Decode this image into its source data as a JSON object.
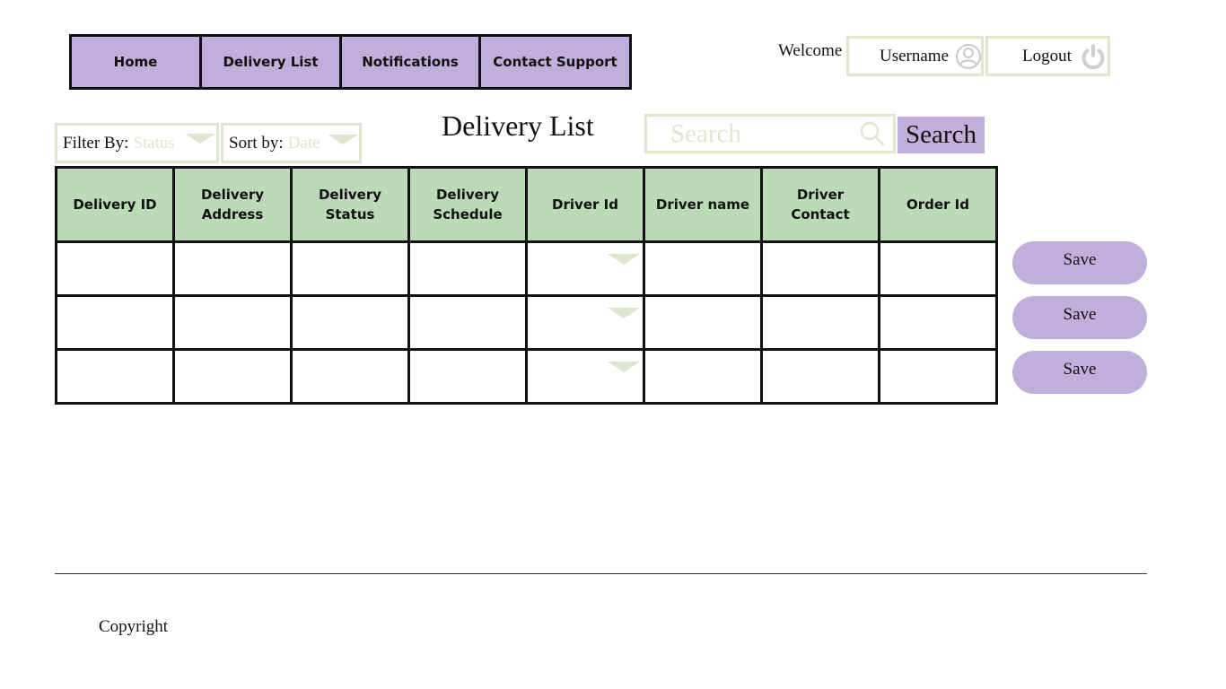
{
  "nav": {
    "items": [
      {
        "label": "Home"
      },
      {
        "label": "Delivery List"
      },
      {
        "label": "Notifications"
      },
      {
        "label": "Contact Support"
      }
    ]
  },
  "header": {
    "welcome": "Welcome",
    "username": "Username",
    "logout": "Logout"
  },
  "filters": {
    "filter_label": "Filter By:",
    "filter_value": "Status",
    "sort_label": "Sort by:",
    "sort_value": "Date"
  },
  "page_title": "Delivery List",
  "search": {
    "placeholder": "Search",
    "button_label": "Search"
  },
  "table": {
    "columns": [
      "Delivery ID",
      "Delivery Address",
      "Delivery Status",
      "Delivery Schedule",
      "Driver Id",
      "Driver name",
      "Driver Contact",
      "Order Id"
    ],
    "rows": [
      [
        "",
        "",
        "",
        "",
        "",
        "",
        "",
        ""
      ],
      [
        "",
        "",
        "",
        "",
        "",
        "",
        "",
        ""
      ],
      [
        "",
        "",
        "",
        "",
        "",
        "",
        "",
        ""
      ]
    ]
  },
  "actions": {
    "save_label": "Save"
  },
  "footer": {
    "copyright": "Copyright"
  },
  "icons": {
    "user": "user-circle-icon",
    "logout": "power-icon",
    "search": "magnifier-icon",
    "dropdown": "triangle-down-icon"
  },
  "colors": {
    "nav_bg": "#c0aedb",
    "header_bg": "#bcdab8",
    "muted_border": "#dfe6cf",
    "button_bg": "#c0aedb"
  }
}
